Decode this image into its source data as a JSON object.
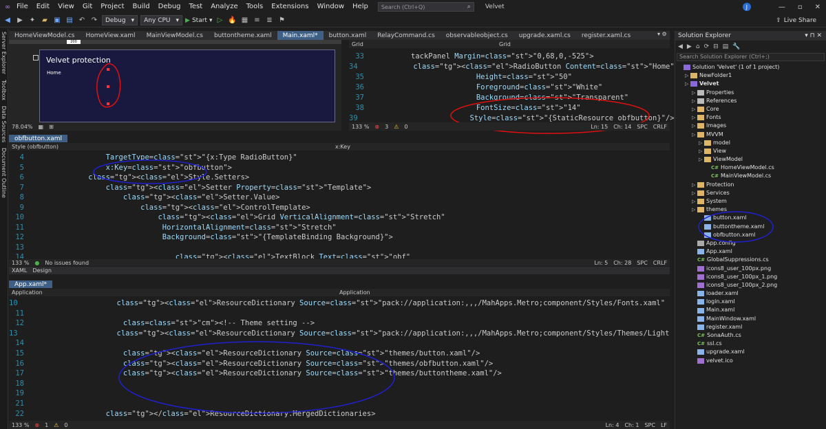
{
  "menu": [
    "File",
    "Edit",
    "View",
    "Git",
    "Project",
    "Build",
    "Debug",
    "Test",
    "Analyze",
    "Tools",
    "Extensions",
    "Window",
    "Help"
  ],
  "search_placeholder": "Search (Ctrl+Q)",
  "app_title": "Velvet",
  "live_share": "Live Share",
  "avatar_letter": "J",
  "toolbar": {
    "debug": "Debug",
    "cpu": "Any CPU",
    "start": "Start"
  },
  "left_rail": [
    "Server Explorer",
    "Toolbox",
    "Data Sources",
    "Document Outline"
  ],
  "doc_tabs": [
    "HomeViewModel.cs",
    "HomeView.xaml",
    "MainViewModel.cs",
    "buttontheme.xaml",
    "Main.xaml*",
    "button.xaml",
    "RelayCommand.cs",
    "observableobject.cs",
    "upgrade.xaml.cs",
    "register.xaml.cs"
  ],
  "designer": {
    "ruler": "200",
    "window_title": "Velvet protection",
    "home_label": "Home",
    "zoom": "78.04%"
  },
  "main_editor": {
    "nav_left": "Grid",
    "nav_right": "Grid",
    "lines": [
      {
        "n": "33",
        "t": "tackPanel Margin=\"0,68,0,-525\">"
      },
      {
        "n": "34",
        "t": "  <RadioButton Content=\"Home\""
      },
      {
        "n": "35",
        "t": "               Height=\"50\""
      },
      {
        "n": "36",
        "t": "               Foreground=\"White\""
      },
      {
        "n": "37",
        "t": "               Background=\"Transparent\""
      },
      {
        "n": "38",
        "t": "               FontSize=\"14\""
      },
      {
        "n": "39",
        "t": "               Style=\"{StaticResource obfbutton}\"/>"
      }
    ],
    "status": {
      "zoom": "133 %",
      "errors": "3",
      "warnings": "0",
      "ln": "Ln: 15",
      "ch": "Ch: 14",
      "spc": "SPC",
      "eol": "CRLF"
    }
  },
  "obf_editor": {
    "tab": "obfbutton.xaml",
    "nav_left": "Style (obfbutton)",
    "nav_right": "x:Key",
    "lines": [
      {
        "n": "4",
        "t": "        TargetType=\"{x:Type RadioButton}\""
      },
      {
        "n": "5",
        "t": "        x:Key=\"obfbutton\">"
      },
      {
        "n": "6",
        "t": "    <Style.Setters>"
      },
      {
        "n": "7",
        "t": "        <Setter Property=\"Template\">"
      },
      {
        "n": "8",
        "t": "            <Setter.Value>"
      },
      {
        "n": "9",
        "t": "                <ControlTemplate>"
      },
      {
        "n": "10",
        "t": "                    <Grid VerticalAlignment=\"Stretch\""
      },
      {
        "n": "11",
        "t": "                     HorizontalAlignment=\"Stretch\""
      },
      {
        "n": "12",
        "t": "                     Background=\"{TemplateBinding Background}\">"
      },
      {
        "n": "13",
        "t": ""
      },
      {
        "n": "14",
        "t": "                        <TextBlock Text=\"obf\""
      }
    ],
    "status": {
      "zoom": "133 %",
      "issues": "No issues found",
      "ln": "Ln: 5",
      "ch": "Ch: 28",
      "spc": "SPC",
      "eol": "CRLF"
    },
    "tabs2": [
      "XAML",
      "Design"
    ]
  },
  "app_editor": {
    "tab": "App.xaml*",
    "nav_left": "Application",
    "nav_right": "Application",
    "lines": [
      {
        "n": "10",
        "t": "            <ResourceDictionary Source=\"pack://application:,,,/MahApps.Metro;component/Styles/Fonts.xaml\" />"
      },
      {
        "n": "11",
        "t": ""
      },
      {
        "n": "12",
        "t": "            <!-- Theme setting -->"
      },
      {
        "n": "13",
        "t": "            <ResourceDictionary Source=\"pack://application:,,,/MahApps.Metro;component/Styles/Themes/Light.Blue.xaml\" />"
      },
      {
        "n": "14",
        "t": ""
      },
      {
        "n": "15",
        "t": "            <ResourceDictionary Source=\"themes/button.xaml\"/>"
      },
      {
        "n": "16",
        "t": "            <ResourceDictionary Source=\"themes/obfbutton.xaml\"/>"
      },
      {
        "n": "17",
        "t": "            <ResourceDictionary Source=\"themes/buttontheme.xaml\"/>"
      },
      {
        "n": "18",
        "t": ""
      },
      {
        "n": "19",
        "t": ""
      },
      {
        "n": "21",
        "t": ""
      },
      {
        "n": "22",
        "t": "        </ResourceDictionary.MergedDictionaries>"
      }
    ],
    "status": {
      "zoom": "133 %",
      "errors": "1",
      "warnings": "0",
      "ln": "Ln: 4",
      "ch": "Ch: 1",
      "spc": "SPC",
      "eol": "LF"
    }
  },
  "solution_explorer": {
    "title": "Solution Explorer",
    "search_placeholder": "Search Solution Explorer (Ctrl+;)",
    "items": [
      {
        "d": 0,
        "t": "Solution 'Velvet' (1 of 1 project)",
        "k": "sln"
      },
      {
        "d": 1,
        "t": "NewFolder1",
        "k": "folder"
      },
      {
        "d": 1,
        "t": "Velvet",
        "k": "proj",
        "b": true
      },
      {
        "d": 2,
        "t": "Properties",
        "k": "prop"
      },
      {
        "d": 2,
        "t": "References",
        "k": "ref"
      },
      {
        "d": 2,
        "t": "Core",
        "k": "folder"
      },
      {
        "d": 2,
        "t": "Fonts",
        "k": "folder"
      },
      {
        "d": 2,
        "t": "Images",
        "k": "folder"
      },
      {
        "d": 2,
        "t": "MVVM",
        "k": "folder"
      },
      {
        "d": 3,
        "t": "model",
        "k": "folder"
      },
      {
        "d": 3,
        "t": "View",
        "k": "folder"
      },
      {
        "d": 3,
        "t": "ViewModel",
        "k": "folder"
      },
      {
        "d": 4,
        "t": "HomeViewModel.cs",
        "k": "cs"
      },
      {
        "d": 4,
        "t": "MainViewModel.cs",
        "k": "cs"
      },
      {
        "d": 2,
        "t": "Protection",
        "k": "folder"
      },
      {
        "d": 2,
        "t": "Services",
        "k": "folder"
      },
      {
        "d": 2,
        "t": "System",
        "k": "folder"
      },
      {
        "d": 2,
        "t": "themes",
        "k": "folder"
      },
      {
        "d": 3,
        "t": "button.xaml",
        "k": "xaml"
      },
      {
        "d": 3,
        "t": "buttontheme.xaml",
        "k": "xaml"
      },
      {
        "d": 3,
        "t": "obfbutton.xaml",
        "k": "xaml"
      },
      {
        "d": 2,
        "t": "App.config",
        "k": "file"
      },
      {
        "d": 2,
        "t": "App.xaml",
        "k": "xaml"
      },
      {
        "d": 2,
        "t": "GlobalSuppressions.cs",
        "k": "cs"
      },
      {
        "d": 2,
        "t": "icons8_user_100px.png",
        "k": "img"
      },
      {
        "d": 2,
        "t": "icons8_user_100px_1.png",
        "k": "img"
      },
      {
        "d": 2,
        "t": "icons8_user_100px_2.png",
        "k": "img"
      },
      {
        "d": 2,
        "t": "loader.xaml",
        "k": "xaml"
      },
      {
        "d": 2,
        "t": "login.xaml",
        "k": "xaml"
      },
      {
        "d": 2,
        "t": "Main.xaml",
        "k": "xaml"
      },
      {
        "d": 2,
        "t": "MainWindow.xaml",
        "k": "xaml"
      },
      {
        "d": 2,
        "t": "register.xaml",
        "k": "xaml"
      },
      {
        "d": 2,
        "t": "SonaAuth.cs",
        "k": "cs"
      },
      {
        "d": 2,
        "t": "ssl.cs",
        "k": "cs"
      },
      {
        "d": 2,
        "t": "upgrade.xaml",
        "k": "xaml"
      },
      {
        "d": 2,
        "t": "velvet.ico",
        "k": "img"
      }
    ]
  },
  "colors": {
    "accent": "#3e5f86",
    "red_annotation": "#e01010",
    "blue_annotation": "#2020d0"
  }
}
